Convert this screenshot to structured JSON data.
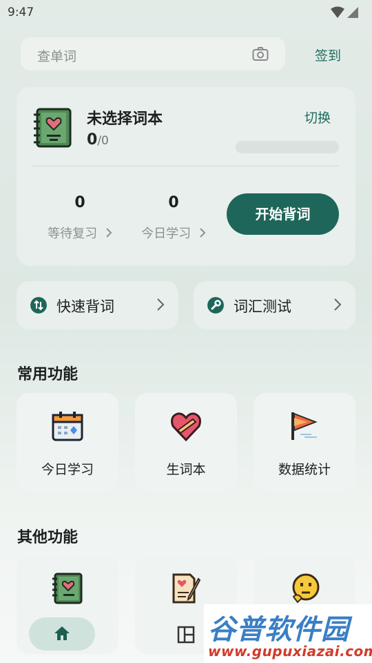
{
  "status_bar": {
    "time": "9:47"
  },
  "search": {
    "placeholder": "查单词",
    "checkin_label": "签到"
  },
  "book_card": {
    "title": "未选择词本",
    "learned": "0",
    "total": "/0",
    "switch_label": "切换",
    "progress": 0,
    "stats": [
      {
        "value": "0",
        "label": "等待复习"
      },
      {
        "value": "0",
        "label": "今日学习"
      }
    ],
    "start_label": "开始背词"
  },
  "quick_actions": [
    {
      "label": "快速背词",
      "icon": "swap-arrows-icon"
    },
    {
      "label": "词汇测试",
      "icon": "wrench-icon"
    }
  ],
  "common_section": {
    "title": "常用功能",
    "items": [
      {
        "label": "今日学习",
        "icon": "calendar-icon"
      },
      {
        "label": "生词本",
        "icon": "heart-book-icon"
      },
      {
        "label": "数据统计",
        "icon": "flag-icon"
      }
    ]
  },
  "other_section": {
    "title": "其他功能",
    "items": [
      {
        "icon": "notebook-heart-icon"
      },
      {
        "icon": "letter-pen-icon"
      },
      {
        "icon": "thinking-face-icon"
      }
    ]
  },
  "bottom_nav": {
    "items": [
      {
        "icon": "home-icon"
      },
      {
        "icon": "layout-icon"
      }
    ]
  },
  "watermark": {
    "title": "谷普软件园",
    "url": "www.gupuxiazai.com"
  },
  "colors": {
    "accent": "#1e6659",
    "background": "#e3ebe7",
    "card": "#e8efec"
  }
}
